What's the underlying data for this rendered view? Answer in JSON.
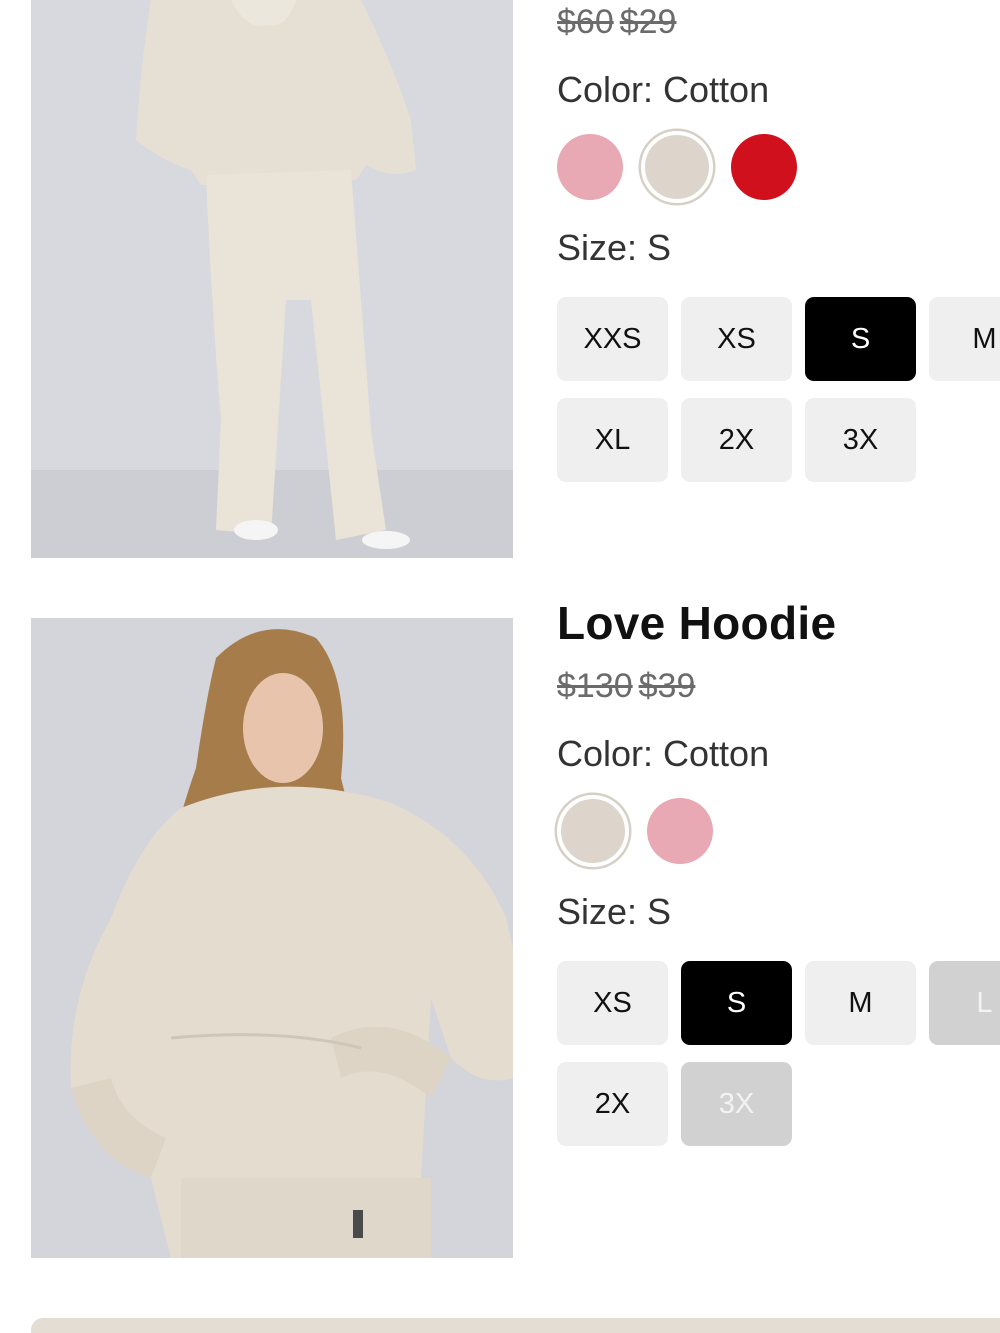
{
  "products": [
    {
      "title": "",
      "price_original": "$60",
      "price_sale": "$29",
      "color_label": "Color: Cotton",
      "colors": [
        {
          "name": "pink",
          "hex": "#e8a8b4",
          "selected": false
        },
        {
          "name": "cotton",
          "hex": "#ddd5cb",
          "selected": true
        },
        {
          "name": "red",
          "hex": "#d0101c",
          "selected": false
        }
      ],
      "size_label": "Size: S",
      "sizes": [
        {
          "label": "XXS",
          "state": "available"
        },
        {
          "label": "XS",
          "state": "available"
        },
        {
          "label": "S",
          "state": "selected"
        },
        {
          "label": "M",
          "state": "available"
        },
        {
          "label": "XL",
          "state": "available"
        },
        {
          "label": "2X",
          "state": "available"
        },
        {
          "label": "3X",
          "state": "available"
        }
      ]
    },
    {
      "title": "Love Hoodie",
      "price_original": "$130",
      "price_sale": "$39",
      "color_label": "Color: Cotton",
      "colors": [
        {
          "name": "cotton",
          "hex": "#ddd5cb",
          "selected": true
        },
        {
          "name": "pink",
          "hex": "#e8a8b4",
          "selected": false
        }
      ],
      "size_label": "Size: S",
      "sizes": [
        {
          "label": "XS",
          "state": "available"
        },
        {
          "label": "S",
          "state": "selected"
        },
        {
          "label": "M",
          "state": "available"
        },
        {
          "label": "L",
          "state": "disabled"
        },
        {
          "label": "2X",
          "state": "available"
        },
        {
          "label": "3X",
          "state": "disabled"
        }
      ]
    }
  ],
  "colors": {
    "selected_bg": "#000000",
    "button_bg": "#efefef",
    "disabled_bg": "#d1d1d1",
    "bottom_bar": "#e4ddd3"
  }
}
